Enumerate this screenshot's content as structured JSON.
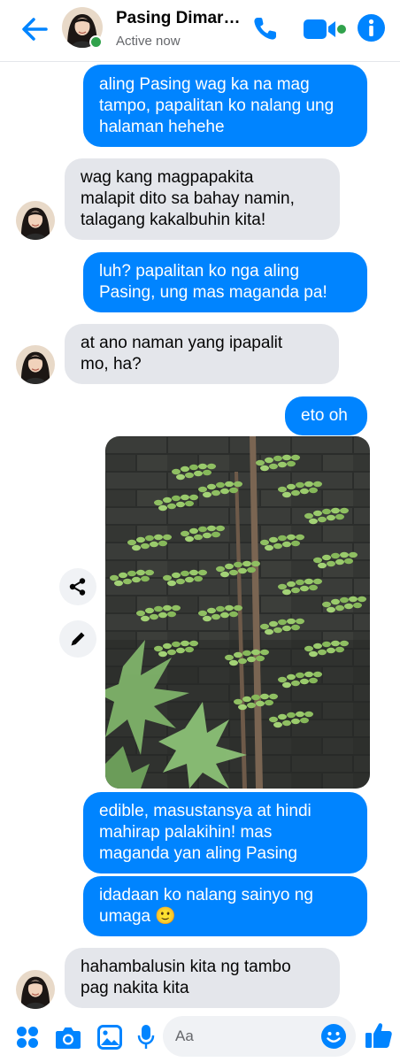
{
  "header": {
    "contact_name": "Pasing Dimara...",
    "status": "Active now"
  },
  "messages": [
    {
      "direction": "out",
      "lines": [
        "aling Pasing wag ka na mag",
        "tampo, papalitan ko nalang ung",
        "halaman hehehe"
      ]
    },
    {
      "direction": "in",
      "lines": [
        "wag kang magpapakita",
        "malapit dito sa bahay namin,",
        "talagang kakalbuhin kita!"
      ]
    },
    {
      "direction": "out",
      "lines": [
        "luh? papalitan ko nga aling",
        "Pasing, ung mas maganda pa!"
      ]
    },
    {
      "direction": "in",
      "lines": [
        "at ano naman yang ipapalit",
        "mo, ha?"
      ]
    },
    {
      "direction": "out",
      "lines": [
        "eto oh"
      ]
    },
    {
      "direction": "out",
      "lines": [
        "edible, masustansya at hindi",
        "mahirap palakihin! mas",
        "maganda yan aling Pasing"
      ]
    },
    {
      "direction": "out",
      "lines": [
        "idadaan ko nalang sainyo ng",
        "umaga 🙂"
      ]
    },
    {
      "direction": "in",
      "lines": [
        "hahambalusin kita ng tambo",
        "pag nakita kita"
      ]
    }
  ],
  "composer": {
    "placeholder": "Aa"
  },
  "icons": {
    "back": "arrow-left-icon",
    "call": "phone-icon",
    "video": "video-camera-icon",
    "info": "info-icon",
    "share": "share-icon",
    "edit": "pencil-icon",
    "apps": "four-dots-icon",
    "camera": "camera-icon",
    "gallery": "image-icon",
    "mic": "microphone-icon",
    "emoji": "smiley-icon",
    "like": "thumbs-up-icon"
  },
  "colors": {
    "accent": "#0084ff",
    "incoming_bubble": "#e4e6eb",
    "online": "#31a24c"
  }
}
